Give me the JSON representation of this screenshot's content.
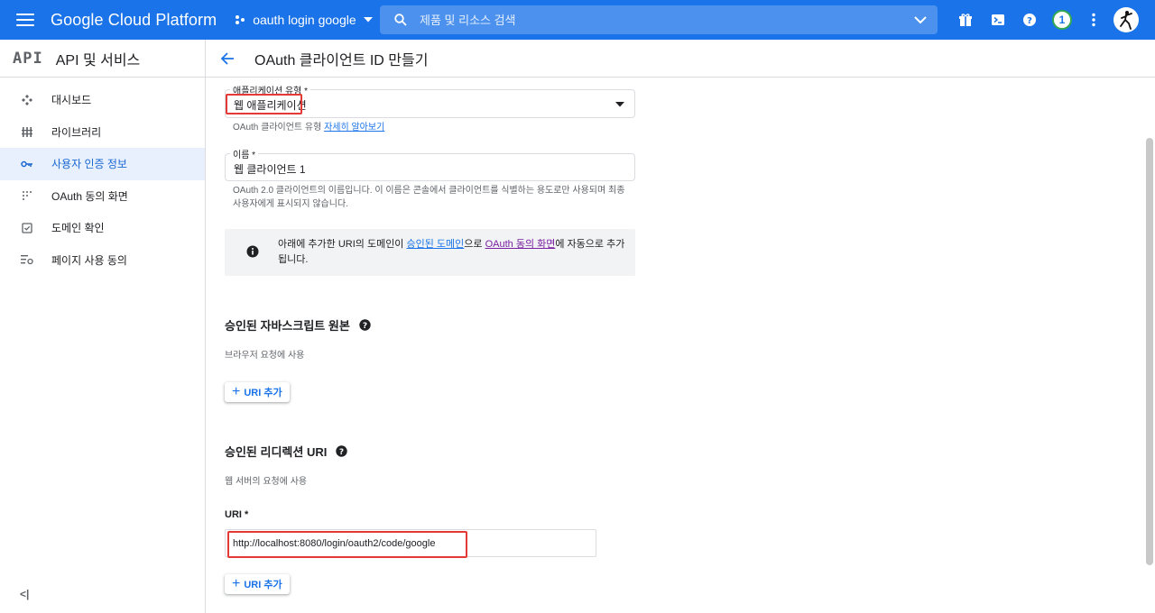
{
  "topbar": {
    "brand": "Google Cloud Platform",
    "project": "oauth login google",
    "search_placeholder": "제품 및 리소스 검색",
    "notification_count": "1",
    "color": "#1a73e8"
  },
  "sidebar": {
    "logo": "API",
    "title": "API 및 서비스",
    "items": [
      {
        "label": "대시보드",
        "icon": "dashboard-icon"
      },
      {
        "label": "라이브러리",
        "icon": "library-icon"
      },
      {
        "label": "사용자 인증 정보",
        "icon": "key-icon",
        "active": true
      },
      {
        "label": "OAuth 동의 화면",
        "icon": "consent-icon"
      },
      {
        "label": "도메인 확인",
        "icon": "checkbox-icon"
      },
      {
        "label": "페이지 사용 동의",
        "icon": "settings-list-icon"
      }
    ],
    "collapse_label": "<|"
  },
  "page": {
    "title": "OAuth 클라이언트 ID 만들기"
  },
  "form": {
    "app_type": {
      "label": "애플리케이션 유형 *",
      "value": "웹 애플리케이션",
      "hint_prefix": "OAuth 클라이언트 유형",
      "hint_link": "자세히 알아보기"
    },
    "name": {
      "label": "이름 *",
      "value": "웹 클라이언트 1",
      "hint": "OAuth 2.0 클라이언트의 이름입니다. 이 이름은 콘솔에서 클라이언트를 식별하는 용도로만 사용되며 최종 사용자에게 표시되지 않습니다."
    },
    "info": {
      "text1": "아래에 추가한 URI의 도메인이 ",
      "link1": "승인된 도메인",
      "text2": "으로 ",
      "link2": "OAuth 동의 화면",
      "text3": "에 자동으로 추가됩니다."
    },
    "js_origins": {
      "title": "승인된 자바스크립트 원본",
      "subtitle": "브라우저 요청에 사용",
      "add_button": "URI 추가"
    },
    "redirect_uris": {
      "title": "승인된 리디렉션 URI",
      "subtitle": "웹 서버의 요청에 사용",
      "uri_label": "URI *",
      "uri_value": "http://localhost:8080/login/oauth2/code/google",
      "add_button": "URI 추가"
    }
  }
}
